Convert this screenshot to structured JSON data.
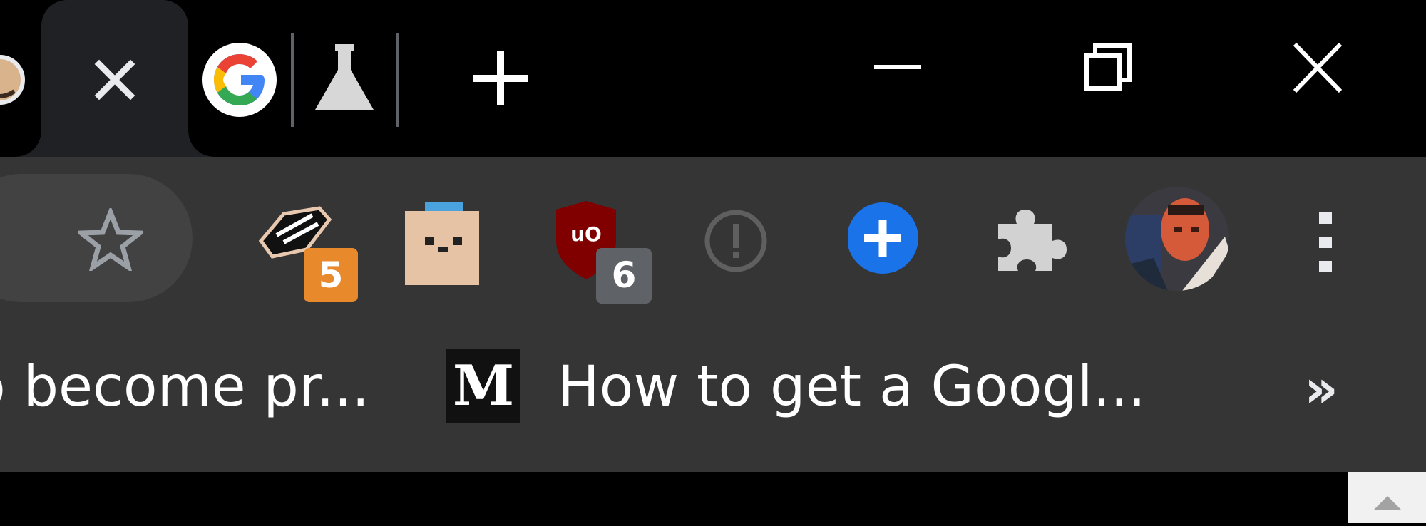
{
  "tabstrip": {
    "active_tab_close_icon": "close-icon",
    "partial_tab_favicon": "avatar-favicon",
    "pinned_favicons": [
      "google-g-icon",
      "flask-icon"
    ],
    "new_tab_icon": "plus-icon"
  },
  "window_controls": [
    "minimize-icon",
    "restore-icon",
    "close-icon"
  ],
  "toolbar": {
    "bookmark_star_icon": "star-outline-icon",
    "extensions": [
      {
        "icon": "stamp-extension-icon",
        "badge": "5",
        "badge_color": "#e8892c"
      },
      {
        "icon": "pixel-face-extension-icon",
        "badge": ""
      },
      {
        "icon": "ublock-origin-icon",
        "badge": "6",
        "badge_color": "#5f6368",
        "logo_text": "uO"
      },
      {
        "icon": "info-circle-icon",
        "badge": ""
      },
      {
        "icon": "blue-plus-circle-icon",
        "badge": "",
        "color": "#1a73e8"
      },
      {
        "icon": "puzzle-piece-icon",
        "badge": ""
      }
    ],
    "profile_icon": "profile-avatar",
    "menu_icon": "kebab-menu-icon"
  },
  "bookmarks": {
    "items": [
      {
        "label": "o become pr...",
        "icon": ""
      },
      {
        "label": "How to get a Googl...",
        "icon": "medium-m-icon",
        "icon_text": "M"
      }
    ],
    "overflow_label": "»"
  },
  "colors": {
    "tabstrip_bg": "#000000",
    "toolbar_bg": "#353535",
    "text": "#ffffff",
    "icon_gray": "#9aa0a6"
  }
}
